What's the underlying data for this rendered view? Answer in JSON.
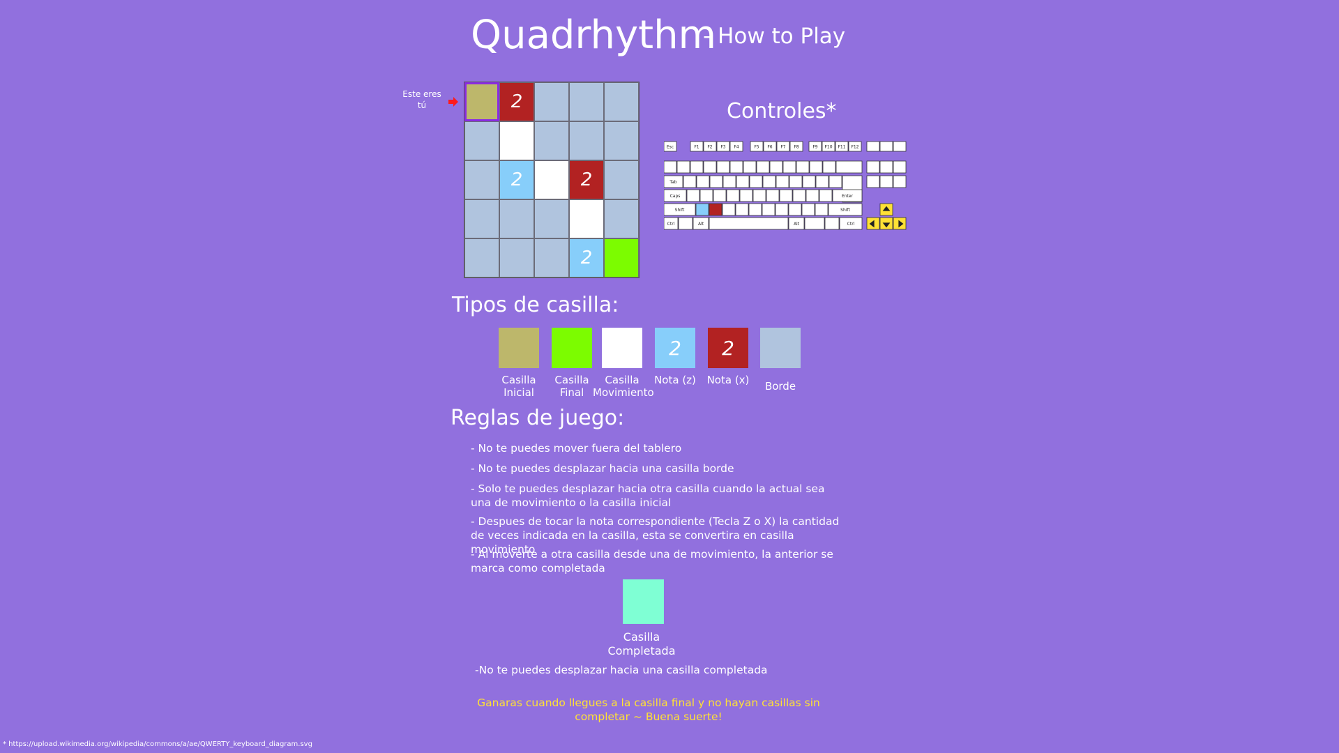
{
  "header": {
    "title": "Quadrhythm",
    "subtitle": "- How to Play"
  },
  "board": {
    "you_label": "Este eres tú",
    "rows": [
      [
        {
          "t": "start",
          "v": ""
        },
        {
          "t": "nx",
          "v": "2"
        },
        {
          "t": "border",
          "v": ""
        },
        {
          "t": "border",
          "v": ""
        },
        {
          "t": "border",
          "v": ""
        }
      ],
      [
        {
          "t": "border",
          "v": ""
        },
        {
          "t": "move",
          "v": ""
        },
        {
          "t": "border",
          "v": ""
        },
        {
          "t": "border",
          "v": ""
        },
        {
          "t": "border",
          "v": ""
        }
      ],
      [
        {
          "t": "border",
          "v": ""
        },
        {
          "t": "nz",
          "v": "2"
        },
        {
          "t": "move",
          "v": ""
        },
        {
          "t": "nx",
          "v": "2"
        },
        {
          "t": "border",
          "v": ""
        }
      ],
      [
        {
          "t": "border",
          "v": ""
        },
        {
          "t": "border",
          "v": ""
        },
        {
          "t": "border",
          "v": ""
        },
        {
          "t": "move",
          "v": ""
        },
        {
          "t": "border",
          "v": ""
        }
      ],
      [
        {
          "t": "border",
          "v": ""
        },
        {
          "t": "border",
          "v": ""
        },
        {
          "t": "border",
          "v": ""
        },
        {
          "t": "nz",
          "v": "2"
        },
        {
          "t": "final",
          "v": ""
        }
      ]
    ]
  },
  "controls": {
    "title": "Controles*",
    "keyboard": {
      "highlight_z": "#87CEFA",
      "highlight_x": "#B22222",
      "highlight_arrows": "#FFE135",
      "function_row": [
        "Esc",
        "F1",
        "F2",
        "F3",
        "F4",
        "F5",
        "F6",
        "F7",
        "F8",
        "F9",
        "F10",
        "F11",
        "F12"
      ],
      "modifier_labels": [
        "Tab",
        "Caps",
        "Shift",
        "Ctrl",
        "Alt",
        "Enter"
      ]
    }
  },
  "tile_types": {
    "title": "Tipos de casilla:",
    "items": [
      {
        "name": "Casilla Inicial",
        "color": "#BDB76B",
        "text": ""
      },
      {
        "name": "Casilla Final",
        "color": "#7CFC00",
        "text": ""
      },
      {
        "name": "Casilla Movimiento",
        "color": "#FFFFFF",
        "text": ""
      },
      {
        "name": "Nota (z)",
        "color": "#87CEFA",
        "text": "2"
      },
      {
        "name": "Nota (x)",
        "color": "#B22222",
        "text": "2"
      },
      {
        "name": "Borde",
        "color": "#B0C4DE",
        "text": ""
      }
    ]
  },
  "rules": {
    "title": "Reglas de juego:",
    "items": [
      "- No te puedes mover fuera del tablero",
      "- No te puedes desplazar hacia una casilla borde",
      "- Solo te puedes desplazar hacia otra casilla cuando la actual sea una de movimiento o la casilla inicial",
      "- Despues de tocar la nota correspondiente (Tecla Z o X) la cantidad de veces indicada en la casilla, esta se convertira en casilla movimiento",
      "- Al moverte a otra casilla desde una de movimiento, la anterior se marca como completada"
    ],
    "completed_label": "Casilla Completada",
    "completed_color": "#7FFFD4",
    "rule_completed": "-No te puedes desplazar hacia una casilla completada",
    "win_text": "Ganaras cuando llegues a la casilla final y no hayan casillas sin completar ~ Buena suerte!"
  },
  "footnote": "* https://upload.wikimedia.org/wikipedia/commons/a/ae/QWERTY_keyboard_diagram.svg"
}
